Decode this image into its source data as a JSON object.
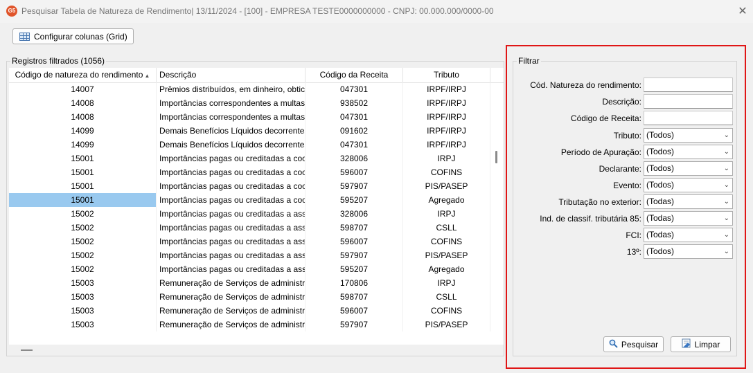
{
  "window": {
    "app_icon_text": "G5",
    "title": "Pesquisar Tabela de Natureza de Rendimento|  13/11/2024 - [100] - EMPRESA TESTE0000000000 - CNPJ: 00.000.000/0000-00",
    "close_symbol": "✕"
  },
  "toolbar": {
    "configure_columns_label": "Configurar colunas (Grid)",
    "configure_icon": "grid-icon"
  },
  "records": {
    "title": "Registros filtrados (1056)",
    "columns": [
      "Código de natureza do rendimento",
      "Descrição",
      "Código da Receita",
      "Tributo"
    ],
    "sort_indicator": "▲",
    "rows": [
      [
        "14007",
        "Prêmios distribuídos, em dinheiro, obtic",
        "047301",
        "IRPF/IRPJ"
      ],
      [
        "14008",
        "Importâncias correspondentes a multas",
        "938502",
        "IRPF/IRPJ"
      ],
      [
        "14008",
        "Importâncias correspondentes a multas",
        "047301",
        "IRPF/IRPJ"
      ],
      [
        "14099",
        "Demais Benefícios Líquidos decorrentes",
        "091602",
        "IRPF/IRPJ"
      ],
      [
        "14099",
        "Demais Benefícios Líquidos decorrentes",
        "047301",
        "IRPF/IRPJ"
      ],
      [
        "15001",
        "Importâncias pagas ou creditadas a coo",
        "328006",
        "IRPJ"
      ],
      [
        "15001",
        "Importâncias pagas ou creditadas a coo",
        "596007",
        "COFINS"
      ],
      [
        "15001",
        "Importâncias pagas ou creditadas a coo",
        "597907",
        "PIS/PASEP"
      ],
      [
        "15001",
        "Importâncias pagas ou creditadas a coo",
        "595207",
        "Agregado"
      ],
      [
        "15002",
        "Importâncias pagas ou creditadas a assc",
        "328006",
        "IRPJ"
      ],
      [
        "15002",
        "Importâncias pagas ou creditadas a assc",
        "598707",
        "CSLL"
      ],
      [
        "15002",
        "Importâncias pagas ou creditadas a assc",
        "596007",
        "COFINS"
      ],
      [
        "15002",
        "Importâncias pagas ou creditadas a assc",
        "597907",
        "PIS/PASEP"
      ],
      [
        "15002",
        "Importâncias pagas ou creditadas a assc",
        "595207",
        "Agregado"
      ],
      [
        "15003",
        "Remuneração de Serviços de administra",
        "170806",
        "IRPJ"
      ],
      [
        "15003",
        "Remuneração de Serviços de administra",
        "598707",
        "CSLL"
      ],
      [
        "15003",
        "Remuneração de Serviços de administra",
        "596007",
        "COFINS"
      ],
      [
        "15003",
        "Remuneração de Serviços de administra",
        "597907",
        "PIS/PASEP"
      ]
    ],
    "selected_row": 8
  },
  "filter": {
    "title": "Filtrar",
    "nature_code_label": "Cód. Natureza do rendimento:",
    "nature_code_value": "",
    "description_label": "Descrição:",
    "description_value": "",
    "revenue_code_label": "Código de Receita:",
    "revenue_code_value": "",
    "tax_label": "Tributo:",
    "tax_value": "(Todos)",
    "period_label": "Período de Apuração:",
    "period_value": "(Todos)",
    "declarant_label": "Declarante:",
    "declarant_value": "(Todos)",
    "event_label": "Evento:",
    "event_value": "(Todos)",
    "abroad_label": "Tributação no exterior:",
    "abroad_value": "(Todas)",
    "ind85_label": "Ind. de classif. tributária 85:",
    "ind85_value": "(Todas)",
    "fci_label": "FCI:",
    "fci_value": "(Todas)",
    "thirteenth_label": "13º:",
    "thirteenth_value": "(Todos)",
    "search_button": "Pesquisar",
    "clear_button": "Limpar",
    "highlight_color": "#e01616",
    "selection_color": "#99c9ef"
  }
}
